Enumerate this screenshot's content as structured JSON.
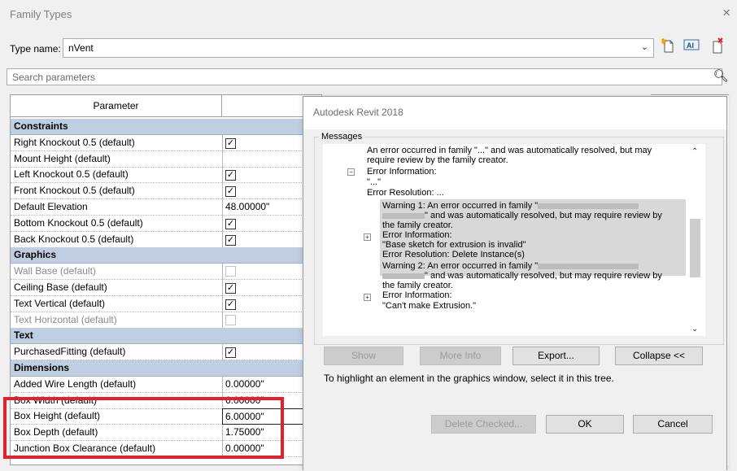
{
  "window": {
    "title": "Family Types",
    "close_glyph": "×"
  },
  "type_name": {
    "label": "Type name:",
    "value": "nVent"
  },
  "toolbar": {
    "new_type_icon": "new-type-icon",
    "rename_type_icon": "rename-type-icon",
    "rename_type_glyph": "AI",
    "delete_type_icon": "delete-type-icon"
  },
  "search": {
    "placeholder": "Search parameters"
  },
  "grid": {
    "header": "Parameter",
    "rows": [
      {
        "kind": "group",
        "name": "Constraints"
      },
      {
        "kind": "param",
        "name": "Right Knockout 0.5 (default)",
        "checkbox": true,
        "checked": true
      },
      {
        "kind": "param",
        "name": "Mount Height (default)",
        "value": ""
      },
      {
        "kind": "param",
        "name": "Left Knockout 0.5 (default)",
        "checkbox": true,
        "checked": true
      },
      {
        "kind": "param",
        "name": "Front Knockout 0.5 (default)",
        "checkbox": true,
        "checked": true
      },
      {
        "kind": "param",
        "name": "Default Elevation",
        "value": "48.00000\""
      },
      {
        "kind": "param",
        "name": "Bottom Knockout 0.5 (default)",
        "checkbox": true,
        "checked": true
      },
      {
        "kind": "param",
        "name": "Back Knockout 0.5 (default)",
        "checkbox": true,
        "checked": true
      },
      {
        "kind": "group",
        "name": "Graphics"
      },
      {
        "kind": "param",
        "name": "Wall Base (default)",
        "checkbox": true,
        "checked": false,
        "disabled": true
      },
      {
        "kind": "param",
        "name": "Ceiling Base (default)",
        "checkbox": true,
        "checked": true
      },
      {
        "kind": "param",
        "name": "Text Vertical (default)",
        "checkbox": true,
        "checked": true
      },
      {
        "kind": "param",
        "name": "Text Horizontal (default)",
        "checkbox": true,
        "checked": false,
        "disabled": true
      },
      {
        "kind": "group",
        "name": "Text"
      },
      {
        "kind": "param",
        "name": "PurchasedFitting (default)",
        "checkbox": true,
        "checked": true
      },
      {
        "kind": "group",
        "name": "Dimensions"
      },
      {
        "kind": "param",
        "name": "Added Wire Length (default)",
        "value": "0.00000\""
      },
      {
        "kind": "param",
        "name": "Box Width (default)",
        "value": "6.00000\""
      },
      {
        "kind": "param",
        "name": "Box Height (default)",
        "value": "6.00000\"",
        "editing": true
      },
      {
        "kind": "param",
        "name": "Box Depth (default)",
        "value": "1.75000\""
      },
      {
        "kind": "param",
        "name": "Junction Box Clearance (default)",
        "value": "0.00000\""
      }
    ],
    "highlight_color": "#e3202c"
  },
  "dialog": {
    "title": "Autodesk Revit 2018",
    "messages_label": "Messages",
    "tree": {
      "l1a": "An error occurred in family \"...\" and was automatically resolved, but may",
      "l1b": "require review by the family creator.",
      "l2": "Error Information:",
      "l3": "\"...\"",
      "l4": "Error Resolution: ...",
      "w1a_prefix": "Warning 1: An error occurred in family \"",
      "w1b_suffix": "\" and was automatically resolved, but may require review by",
      "w1c": "the family creator.",
      "w1d": "Error Information:",
      "w1e": "\"Base sketch for extrusion is invalid\"",
      "w1f": "Error Resolution: Delete Instance(s)",
      "w2a_prefix": "Warning 2: An error occurred in family \"",
      "w2b_suffix": "\" and was automatically resolved, but may require review by",
      "w2c": "the family creator.",
      "w2d": "Error Information:",
      "w2e": "\"Can't make Extrusion.\""
    },
    "buttons": {
      "show": "Show",
      "more_info": "More Info",
      "export": "Export...",
      "collapse": "Collapse <<",
      "delete_checked": "Delete Checked...",
      "ok": "OK",
      "cancel": "Cancel"
    },
    "hint": "To highlight an element in the graphics window, select it in this tree."
  }
}
